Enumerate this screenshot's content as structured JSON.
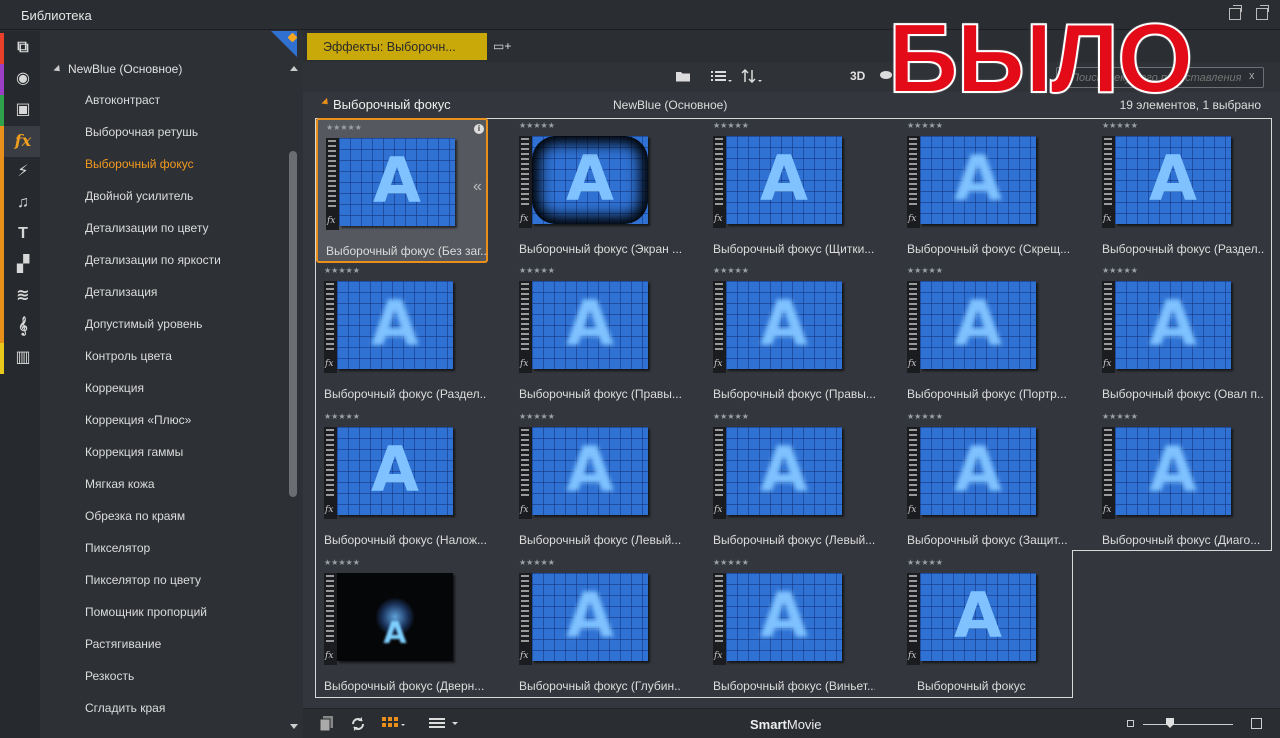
{
  "window": {
    "title": "Библиотека"
  },
  "sidebar_categories": [
    {
      "name": "projects-icon",
      "glyph": "⧉",
      "stripe": "#e8402a"
    },
    {
      "name": "film-reel-icon",
      "glyph": "◉",
      "stripe": "#9b3fc4"
    },
    {
      "name": "photos-icon",
      "glyph": "▣",
      "stripe": "#2fa14a"
    },
    {
      "name": "fx-icon",
      "glyph": "fx",
      "stripe": "#e8901a",
      "active": true
    },
    {
      "name": "transition-icon",
      "glyph": "⚡",
      "stripe": "#e8901a"
    },
    {
      "name": "music-icon",
      "glyph": "♫",
      "stripe": "#e8901a"
    },
    {
      "name": "title-icon",
      "glyph": "T",
      "stripe": "#e8901a"
    },
    {
      "name": "montage-icon",
      "glyph": "▞",
      "stripe": "#e8901a"
    },
    {
      "name": "layers-icon",
      "glyph": "≋",
      "stripe": "#e8901a"
    },
    {
      "name": "audio-effect-icon",
      "glyph": "𝄞",
      "stripe": "#e8901a"
    },
    {
      "name": "piano-icon",
      "glyph": "▥",
      "stripe": "#e8c81a"
    }
  ],
  "tree": {
    "root": "NewBlue (Основное)",
    "items": [
      "Автоконтраст",
      "Выборочная ретушь",
      "Выборочный фокус",
      "Двойной усилитель",
      "Детализации по цвету",
      "Детализации по яркости",
      "Детализация",
      "Допустимый уровень",
      "Контроль цвета",
      "Коррекция",
      "Коррекция «Плюс»",
      "Коррекция гаммы",
      "Мягкая кожа",
      "Обрезка по краям",
      "Пикселятор",
      "Пикселятор по цвету",
      "Помощник пропорций",
      "Растягивание",
      "Резкость",
      "Сгладить края"
    ],
    "selected_index": 2
  },
  "tab": {
    "label": "Эффекты: Выборочн..."
  },
  "toolbar": {
    "label_3d": "3D",
    "search_placeholder": "Поиск текущего представления",
    "search_clear": "x"
  },
  "group": {
    "title": "Выборочный фокус",
    "subtitle": "NewBlue (Основное)",
    "count": "19 элементов, 1 выбрано"
  },
  "items": [
    {
      "label": "Выборочный фокус (Без заг...",
      "style": "sharp",
      "selected": true
    },
    {
      "label": "Выборочный фокус (Экран ...",
      "style": "vignette"
    },
    {
      "label": "Выборочный фокус (Щитки...",
      "style": "sharp"
    },
    {
      "label": "Выборочный фокус (Скрещ...",
      "style": "blur"
    },
    {
      "label": "Выборочный фокус (Раздел...",
      "style": "sharp"
    },
    {
      "label": "Выборочный фокус (Раздел...",
      "style": "blur"
    },
    {
      "label": "Выборочный фокус (Правы...",
      "style": "blur"
    },
    {
      "label": "Выборочный фокус (Правы...",
      "style": "blur"
    },
    {
      "label": "Выборочный фокус (Портр...",
      "style": "blur"
    },
    {
      "label": "Выборочный фокус (Овал п...",
      "style": "blur"
    },
    {
      "label": "Выборочный фокус (Налож...",
      "style": "sharp"
    },
    {
      "label": "Выборочный фокус (Левый...",
      "style": "blur"
    },
    {
      "label": "Выборочный фокус (Левый...",
      "style": "blur"
    },
    {
      "label": "Выборочный фокус (Защит...",
      "style": "blur"
    },
    {
      "label": "Выборочный фокус (Диаго...",
      "style": "blur"
    },
    {
      "label": "Выборочный фокус (Дверн...",
      "style": "dark"
    },
    {
      "label": "Выборочный фокус (Глубин...",
      "style": "blur"
    },
    {
      "label": "Выборочный фокус (Виньет...",
      "style": "blur"
    },
    {
      "label": "Выборочный фокус",
      "style": "sharp"
    }
  ],
  "thumb_glyph": "A",
  "fx_mark": "fx",
  "stars": "★★★★★",
  "bottombar": {
    "smart_bold": "Smart",
    "smart_rest": "Movie"
  },
  "overlay_stamp": "БЫЛО",
  "colors": {
    "accent": "#e8901a",
    "tab": "#c9a90a",
    "stamp": "#e30b17",
    "thumb": "#2f72d4"
  }
}
